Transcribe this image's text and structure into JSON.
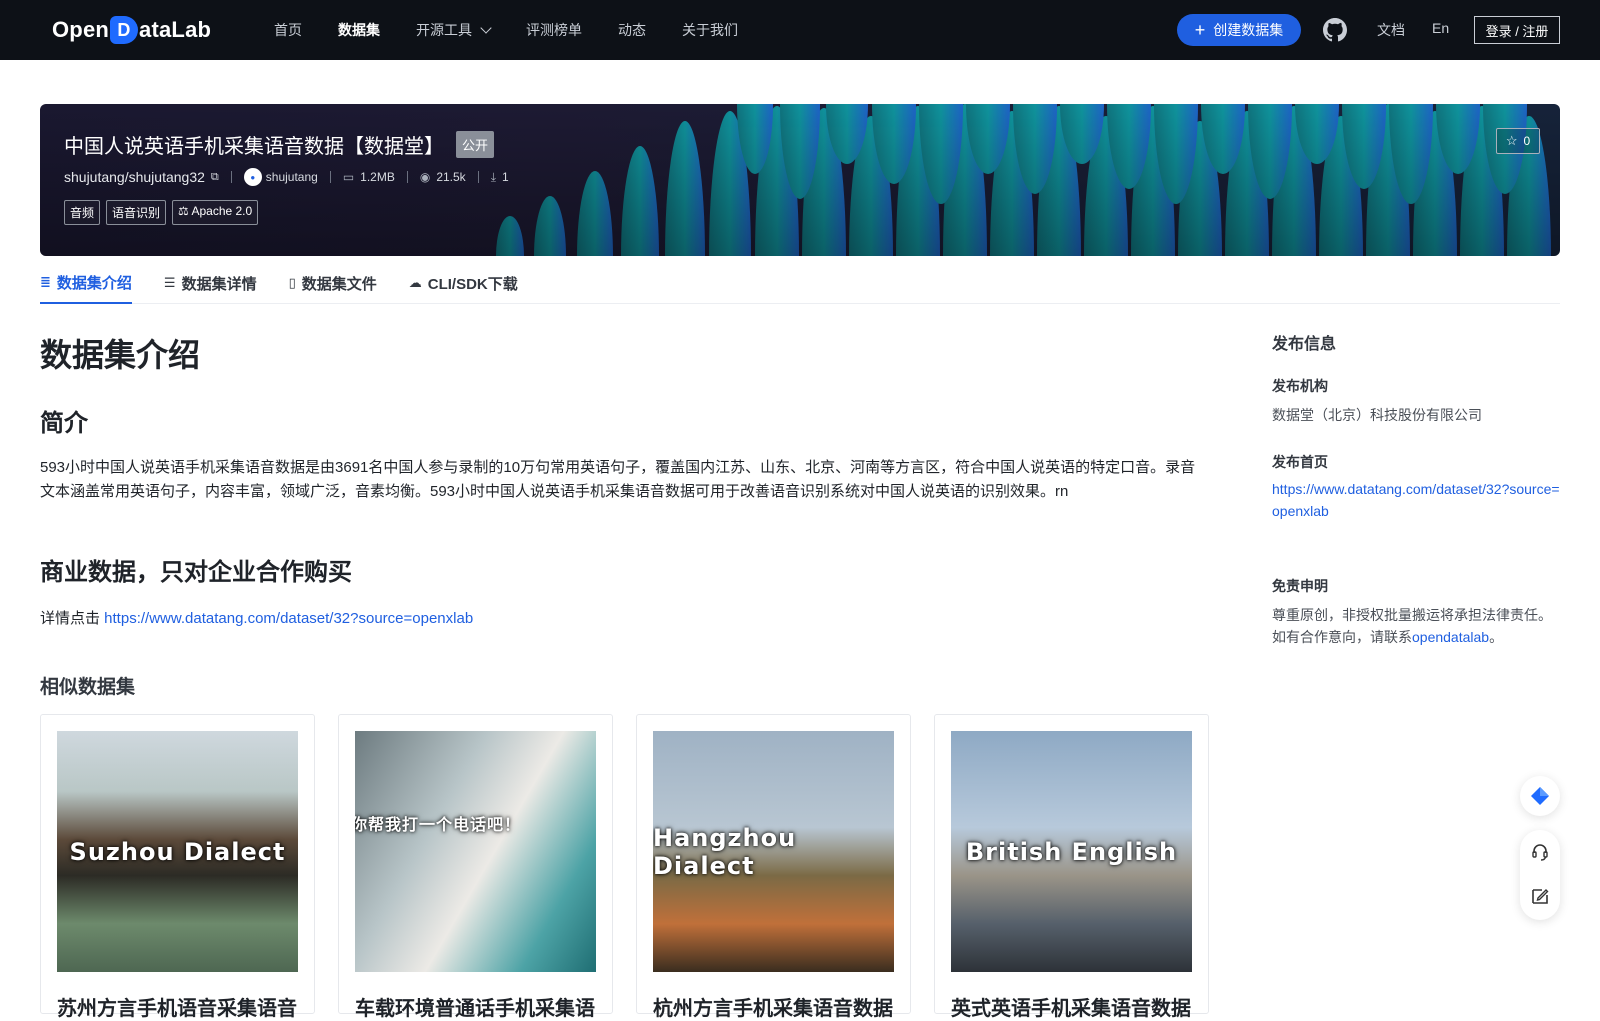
{
  "topnav": {
    "logo_pre": "Open",
    "logo_mark": "D",
    "logo_post": "ataLab",
    "items": [
      {
        "label": "首页"
      },
      {
        "label": "数据集",
        "active": true
      },
      {
        "label": "开源工具",
        "has_dropdown": true
      },
      {
        "label": "评测榜单"
      },
      {
        "label": "动态"
      },
      {
        "label": "关于我们"
      }
    ],
    "create_label": "创建数据集",
    "github_icon": "github-icon",
    "docs_label": "文档",
    "lang_label": "En",
    "login_label": "登录 / 注册"
  },
  "hero": {
    "title": "中国人说英语手机采集语音数据【数据堂】",
    "visibility": "公开",
    "star_count": "0",
    "repo": "shujutang/shujutang32",
    "publisher": "shujutang",
    "size": "1.2MB",
    "views": "21.5k",
    "downloads": "1",
    "tags": [
      "音频",
      "语音识别"
    ],
    "license": "Apache 2.0"
  },
  "tabs": [
    {
      "label": "数据集介绍",
      "active": true
    },
    {
      "label": "数据集详情"
    },
    {
      "label": "数据集文件"
    },
    {
      "label": "CLI/SDK下载"
    }
  ],
  "main": {
    "title": "数据集介绍",
    "intro_heading": "简介",
    "intro_text": "593小时中国人说英语手机采集语音数据是由3691名中国人参与录制的10万句常用英语句子，覆盖国内江苏、山东、北京、河南等方言区，符合中国人说英语的特定口音。录音文本涵盖常用英语句子，内容丰富，领域广泛，音素均衡。593小时中国人说英语手机采集语音数据可用于改善语音识别系统对中国人说英语的识别效果。rn",
    "commerce_heading": "商业数据，只对企业合作购买",
    "detail_prefix": "详情点击 ",
    "detail_link": "https://www.datatang.com/dataset/32?source=openxlab",
    "similar_heading": "相似数据集",
    "similar": [
      {
        "image_text": "Suzhou Dialect",
        "title": "苏州方言手机语音采集语音"
      },
      {
        "image_text": "你帮我打一个电话吧！",
        "title": "车载环境普通话手机采集语"
      },
      {
        "image_text": "Hangzhou Dialect",
        "title": "杭州方言手机采集语音数据"
      },
      {
        "image_text": "British English",
        "title": "英式英语手机采集语音数据"
      }
    ]
  },
  "sidebar": {
    "heading": "发布信息",
    "org_label": "发布机构",
    "org_value": "数据堂（北京）科技股份有限公司",
    "home_label": "发布首页",
    "home_link": "https://www.datatang.com/dataset/32?source=openxlab",
    "disclaimer_label": "免责申明",
    "disclaimer_line1": "尊重原创，非授权批量搬运将承担法律责任。",
    "disclaimer_line2_prefix": "如有合作意向，请联系",
    "disclaimer_contact": "opendatalab",
    "disclaimer_suffix": "。"
  },
  "colors": {
    "nav_bg": "#0d1117",
    "accent": "#1f5fe0"
  }
}
